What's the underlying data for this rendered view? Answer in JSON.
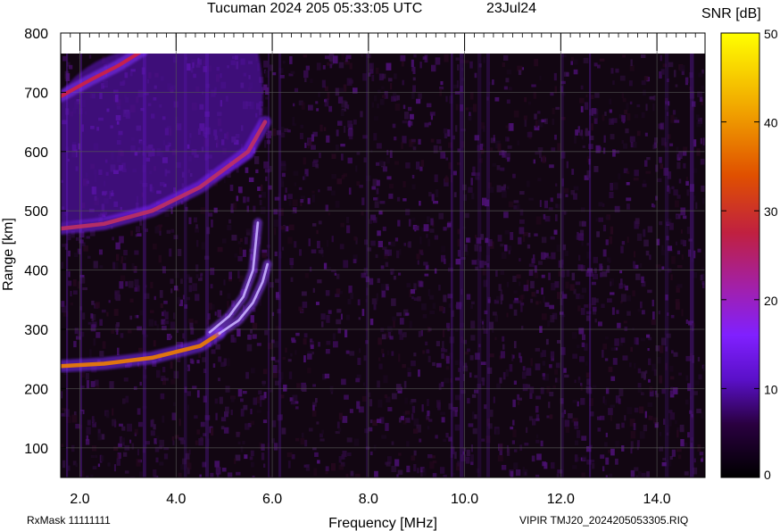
{
  "chart_data": {
    "type": "heatmap",
    "title": "Tucuman 2024 205 05:33:05 UTC",
    "date": "23Jul24",
    "xlabel": "Frequency [MHz]",
    "ylabel": "Range [km]",
    "xlim": [
      1.6,
      15.0
    ],
    "ylim": [
      50,
      800
    ],
    "x_ticks": [
      "2.0",
      "4.0",
      "6.0",
      "8.0",
      "10.0",
      "12.0",
      "14.0"
    ],
    "y_ticks": [
      "100",
      "200",
      "300",
      "400",
      "500",
      "600",
      "700",
      "800"
    ],
    "colorbar": {
      "label": "SNR [dB]",
      "range": [
        0,
        50
      ],
      "ticks": [
        "0",
        "10",
        "20",
        "30",
        "40",
        "50"
      ]
    },
    "grid": true,
    "traces": [
      {
        "x": [
          1.6,
          2.5,
          3.5,
          4.5,
          4.9
        ],
        "y": [
          238,
          242,
          252,
          272,
          293
        ]
      },
      {
        "x": [
          4.9,
          5.3,
          5.6,
          5.8,
          5.9
        ],
        "y": [
          293,
          315,
          345,
          380,
          410
        ]
      },
      {
        "x": [
          4.7,
          5.1,
          5.4,
          5.6,
          5.7
        ],
        "y": [
          295,
          322,
          355,
          400,
          480
        ]
      },
      {
        "x": [
          1.6,
          2.5,
          3.5,
          4.5,
          5.5,
          5.85
        ],
        "y": [
          470,
          478,
          500,
          540,
          600,
          650
        ]
      },
      {
        "x": [
          1.6,
          2.2,
          2.8,
          3.3
        ],
        "y": [
          693,
          720,
          745,
          770
        ]
      }
    ]
  },
  "footer": {
    "left": "RxMask 11111111",
    "right": "VIPIR  TMJ20_2024205053305.RIQ"
  }
}
